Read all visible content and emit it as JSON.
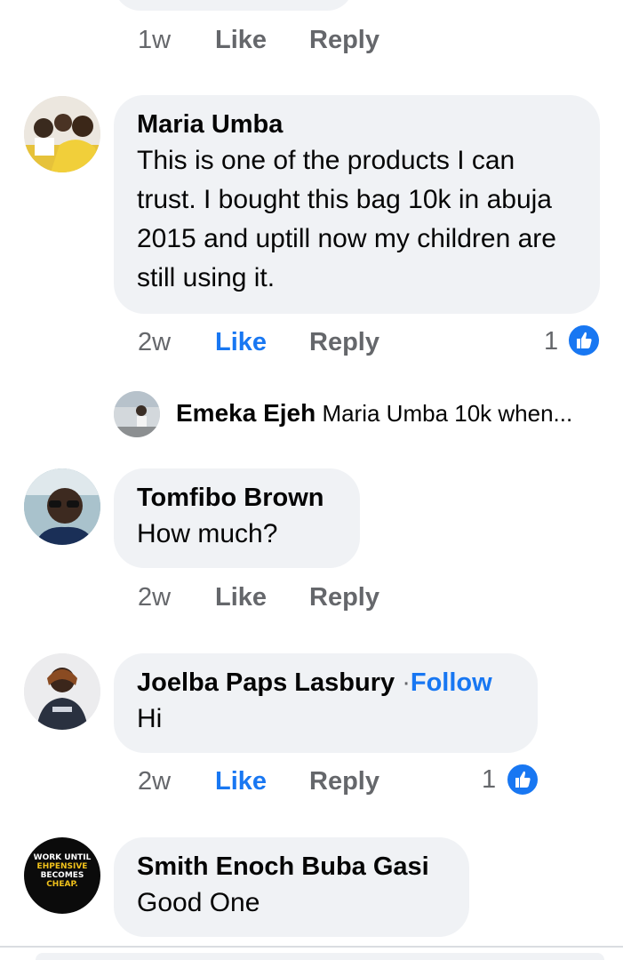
{
  "top_comment": {
    "time": "1w",
    "like": "Like",
    "reply": "Reply"
  },
  "comments": [
    {
      "author": "Maria Umba",
      "text": "This is one of the products I can trust. I bought this bag 10k in abuja 2015 and uptill now my children are still using it.",
      "time": "2w",
      "like": "Like",
      "reply": "Reply",
      "reactions": "1",
      "reply_preview": {
        "author": "Emeka Ejeh",
        "text": "Maria Umba 10k when..."
      }
    },
    {
      "author": "Tomfibo Brown",
      "text": "How much?",
      "time": "2w",
      "like": "Like",
      "reply": "Reply"
    },
    {
      "author": "Joelba Paps Lasbury",
      "follow_separator": "·",
      "follow": "Follow",
      "text": "Hi",
      "time": "2w",
      "like": "Like",
      "reply": "Reply",
      "reactions": "1"
    },
    {
      "author": "Smith Enoch Buba Gasi",
      "text": "Good One",
      "avatar_text": [
        "WORK UNTIL",
        "EHPENSIVE",
        "BECOMES",
        "CHEAP."
      ]
    }
  ],
  "colors": {
    "bubble": "#f0f2f5",
    "accent": "#1877f2",
    "meta": "#65676b"
  }
}
